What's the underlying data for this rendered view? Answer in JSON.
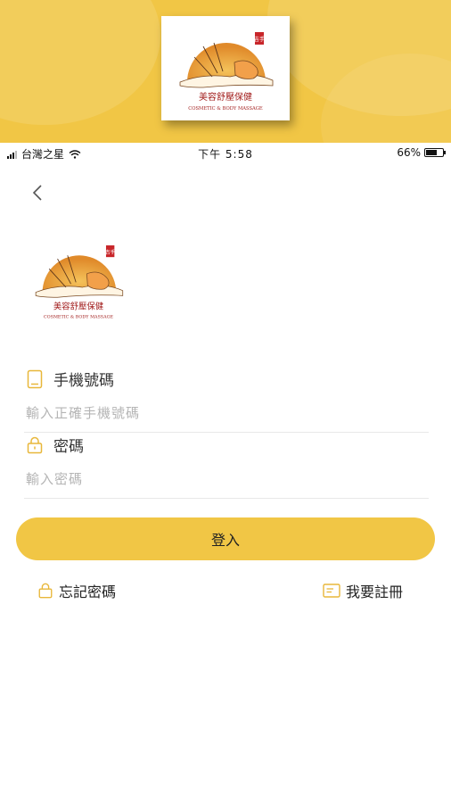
{
  "status_bar": {
    "carrier": "台灣之星",
    "time": "下午 5:58",
    "battery_percent": "66%",
    "battery_level": 0.66
  },
  "logo": {
    "title": "美容舒壓保健",
    "subtitle": "COSMETIC & BODY MASSAGE",
    "seal": "吉手"
  },
  "login_form": {
    "phone_label": "手機號碼",
    "phone_placeholder": "輸入正確手機號碼",
    "password_label": "密碼",
    "password_placeholder": "輸入密碼",
    "login_button": "登入",
    "forgot_password": "忘記密碼",
    "register": "我要註冊"
  },
  "colors": {
    "accent": "#f1c645",
    "icon": "#e8b73a"
  }
}
